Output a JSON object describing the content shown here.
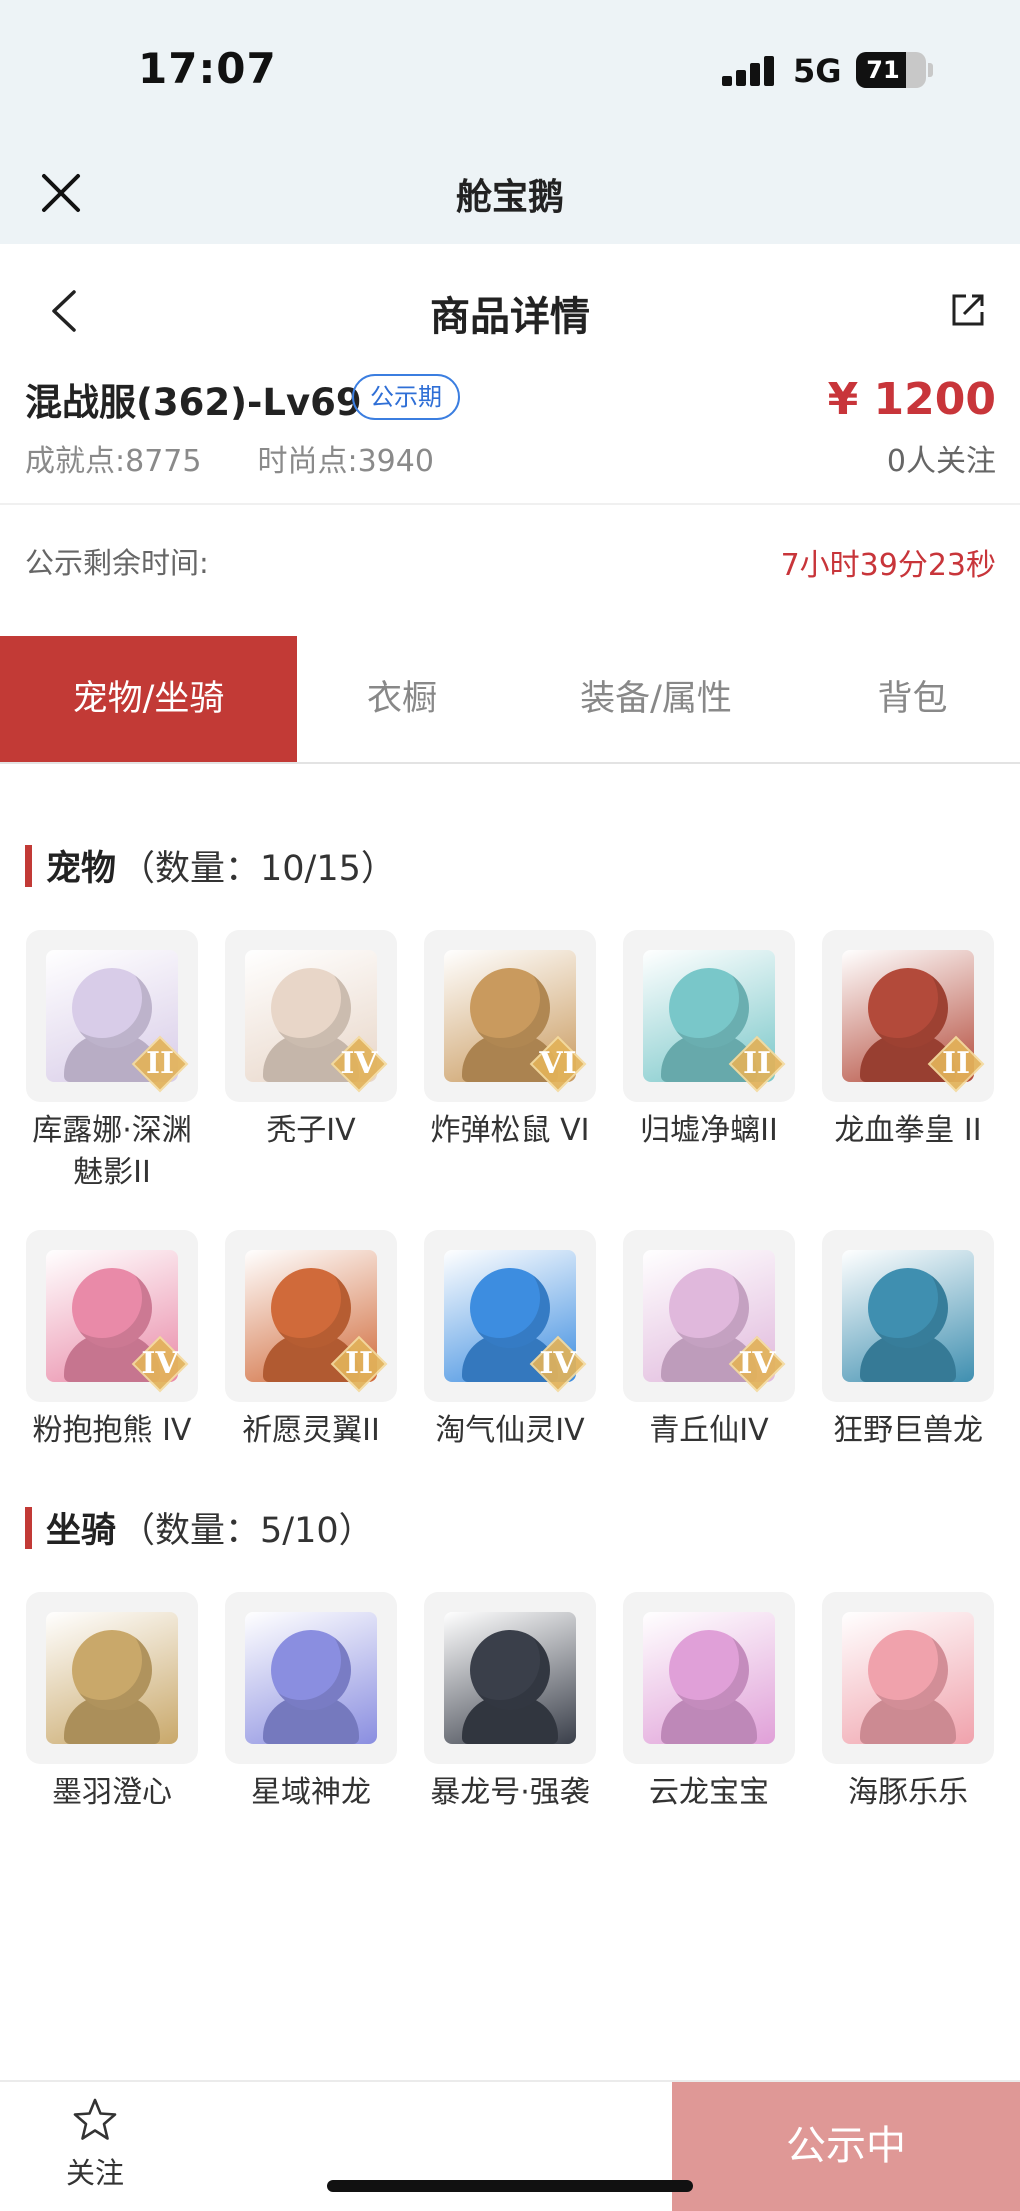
{
  "status_bar": {
    "time": "17:07",
    "network": "5G",
    "battery": "71",
    "battery_level": 0.71
  },
  "mini_program": {
    "title": "舱宝鹅"
  },
  "header": {
    "title": "商品详情"
  },
  "item": {
    "title": "混战服(362)-Lv69",
    "badge": "公示期",
    "price": "¥ 1200",
    "achievement_label": "成就点:",
    "achievement_value": "8775",
    "fashion_label": "时尚点:",
    "fashion_value": "3940",
    "followers": "0人关注"
  },
  "countdown": {
    "label": "公示剩余时间:",
    "value": "7小时39分23秒"
  },
  "tabs": [
    {
      "label": "宠物/坐骑",
      "active": true
    },
    {
      "label": "衣橱",
      "active": false
    },
    {
      "label": "装备/属性",
      "active": false
    },
    {
      "label": "背包",
      "active": false
    }
  ],
  "pets": {
    "name": "宠物",
    "count": "（数量：10/15）",
    "items": [
      {
        "name": "库露娜·深渊魅影II",
        "rank": "II",
        "color": "#d8cce8"
      },
      {
        "name": "秃子IV",
        "rank": "IV",
        "color": "#e8d6c8"
      },
      {
        "name": "炸弹松鼠 VI",
        "rank": "VI",
        "color": "#c99a5e"
      },
      {
        "name": "归墟净螭II",
        "rank": "II",
        "color": "#79c7c9"
      },
      {
        "name": "龙血拳皇 II",
        "rank": "II",
        "color": "#b34a3a"
      },
      {
        "name": "粉抱抱熊 IV",
        "rank": "IV",
        "color": "#e98aa8"
      },
      {
        "name": "祈愿灵翼II",
        "rank": "II",
        "color": "#d06a3a"
      },
      {
        "name": "淘气仙灵IV",
        "rank": "IV",
        "color": "#3d8de0"
      },
      {
        "name": "青丘仙IV",
        "rank": "IV",
        "color": "#e0b8dc"
      },
      {
        "name": "狂野巨兽龙",
        "rank": "",
        "color": "#3f8fb0"
      }
    ]
  },
  "mounts": {
    "name": "坐骑",
    "count": "（数量：5/10）",
    "items": [
      {
        "name": "墨羽澄心",
        "color": "#c9a86a"
      },
      {
        "name": "星域神龙",
        "color": "#8a8ee0"
      },
      {
        "name": "暴龙号·强袭",
        "color": "#3a3f4a"
      },
      {
        "name": "云龙宝宝",
        "color": "#e0a0d8"
      },
      {
        "name": "海豚乐乐",
        "color": "#f0a2ac"
      }
    ]
  },
  "bottom_bar": {
    "follow_label": "关注",
    "cta_label": "公示中"
  },
  "colors": {
    "accent": "#c23a36",
    "price": "#c8353a",
    "badge": "#2f6fd6",
    "cta_disabled": "#df9896"
  }
}
